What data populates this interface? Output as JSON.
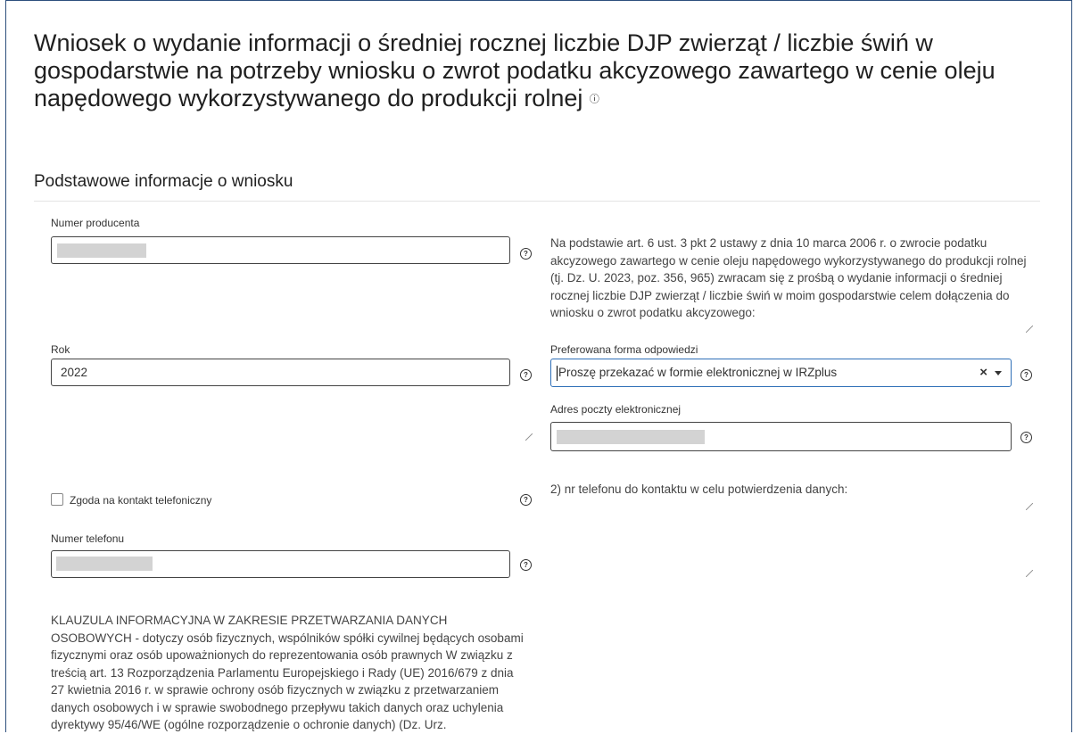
{
  "page": {
    "title": "Wniosek o wydanie informacji o średniej rocznej liczbie DJP zwierząt / liczbie świń w gospodarstwie na potrzeby wniosku o zwrot podatku akcyzowego zawartego w cenie oleju napędowego wykorzystywanego do produkcji rolnej"
  },
  "section": {
    "title": "Podstawowe informacje o wniosku"
  },
  "fields": {
    "producer_number": {
      "label": "Numer producenta",
      "value": ""
    },
    "year": {
      "label": "Rok",
      "value": "2022"
    },
    "consent_phone": {
      "label": "Zgoda na kontakt telefoniczny"
    },
    "phone": {
      "label": "Numer telefonu",
      "value": ""
    },
    "preferred_form": {
      "label": "Preferowana forma odpowiedzi",
      "value": "Proszę przekazać w formie elektronicznej w IRZplus"
    },
    "email": {
      "label": "Adres poczty elektronicznej",
      "value": ""
    }
  },
  "texts": {
    "legal_basis": "Na podstawie art. 6 ust. 3 pkt 2 ustawy z dnia 10 marca 2006 r. o zwrocie podatku akcyzowego zawartego w cenie oleju napędowego wykorzystywanego do produkcji rolnej (tj. Dz. U. 2023, poz. 356, 965) zwracam się z prośbą o wydanie informacji o średniej rocznej liczbie DJP zwierząt / liczbie świń w moim gospodarstwie celem dołączenia do wniosku o zwrot podatku akcyzowego:",
    "phone_note": "2) nr telefonu do kontaktu w celu potwierdzenia danych:",
    "clause": "KLAUZULA INFORMACYJNA W ZAKRESIE PRZETWARZANIA DANYCH OSOBOWYCH - dotyczy osób fizycznych, wspólników spółki cywilnej będących osobami fizycznymi oraz osób upoważnionych do reprezentowania osób prawnych W związku z treścią art. 13 Rozporządzenia Parlamentu Europejskiego i Rady (UE) 2016/679 z dnia 27 kwietnia 2016 r. w sprawie ochrony osób fizycznych w związku z przetwarzaniem danych osobowych i w sprawie swobodnego przepływu takich danych oraz uchylenia dyrektywy 95/46/WE (ogólne rozporządzenie o ochronie danych) (Dz. Urz."
  },
  "icons": {
    "help": "question-circle-icon",
    "clear": "close-icon",
    "dropdown": "chevron-down-icon",
    "resize": "resize-handle-icon"
  },
  "glyphs": {
    "help": "?",
    "clear": "×"
  },
  "colors": {
    "frame_border": "#2d4f7c",
    "select_focus_border": "#2e6fb7",
    "redaction": "#d3d3d3"
  }
}
